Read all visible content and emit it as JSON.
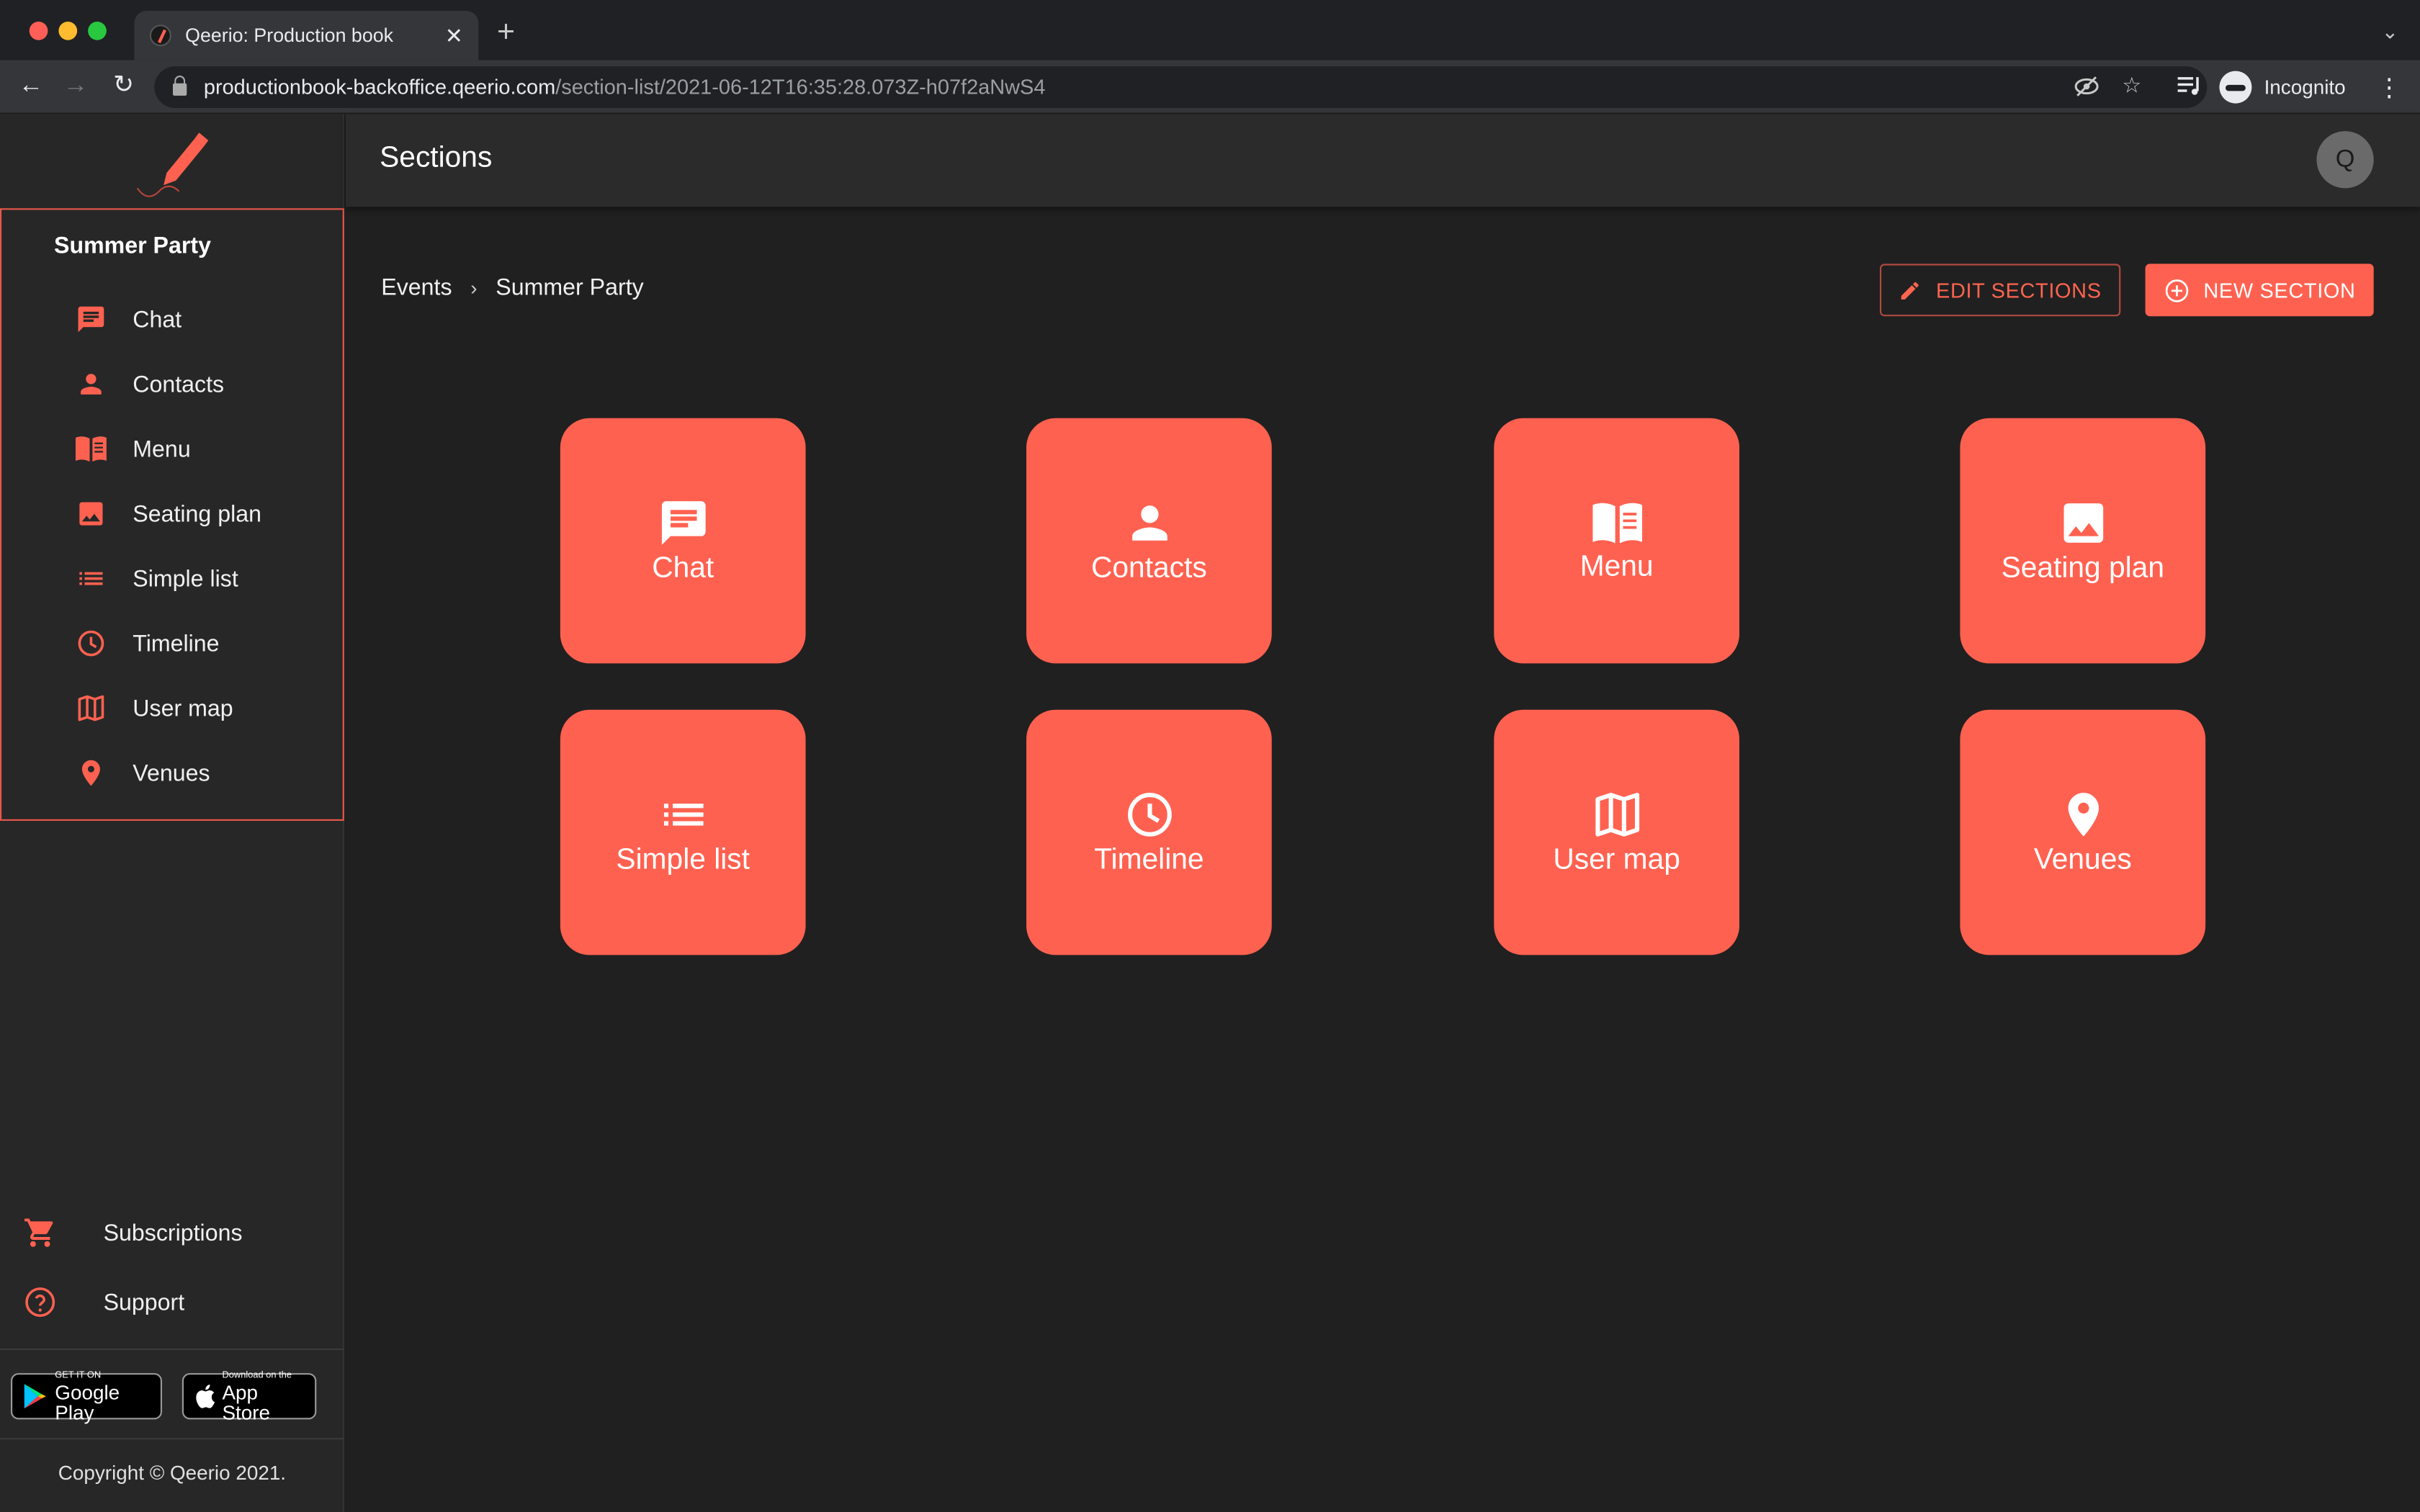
{
  "browser": {
    "tab_title": "Qeerio: Production book",
    "tab_close": "✕",
    "new_tab": "+",
    "url_host": "productionbook-backoffice.qeerio.com",
    "url_path": "/section-list/2021-06-12T16:35:28.073Z-h07f2aNwS4",
    "profile_label": "Incognito"
  },
  "colors": {
    "accent": "#ff6150",
    "background": "#202020",
    "sidebar": "#272727"
  },
  "sidebar": {
    "event_title": "Summer Party",
    "items": [
      {
        "label": "Chat",
        "icon": "chat-icon"
      },
      {
        "label": "Contacts",
        "icon": "person-icon"
      },
      {
        "label": "Menu",
        "icon": "book-icon"
      },
      {
        "label": "Seating plan",
        "icon": "image-icon"
      },
      {
        "label": "Simple list",
        "icon": "list-icon"
      },
      {
        "label": "Timeline",
        "icon": "clock-icon"
      },
      {
        "label": "User map",
        "icon": "map-icon"
      },
      {
        "label": "Venues",
        "icon": "location-pin-icon"
      }
    ],
    "footer_items": [
      {
        "label": "Subscriptions",
        "icon": "cart-icon"
      },
      {
        "label": "Support",
        "icon": "help-icon"
      }
    ],
    "google_play": {
      "small": "GET IT ON",
      "big": "Google Play"
    },
    "app_store": {
      "small": "Download on the",
      "big": "App Store"
    },
    "copyright": "Copyright © Qeerio 2021."
  },
  "header": {
    "title": "Sections",
    "avatar_letter": "Q"
  },
  "breadcrumb": {
    "items": [
      "Events",
      "Summer Party"
    ],
    "separator": "›"
  },
  "actions": {
    "edit_label": "EDIT SECTIONS",
    "new_label": "NEW SECTION"
  },
  "tiles": [
    {
      "label": "Chat",
      "icon": "chat-icon"
    },
    {
      "label": "Contacts",
      "icon": "person-icon"
    },
    {
      "label": "Menu",
      "icon": "book-icon"
    },
    {
      "label": "Seating plan",
      "icon": "image-icon"
    },
    {
      "label": "Simple list",
      "icon": "list-icon"
    },
    {
      "label": "Timeline",
      "icon": "clock-icon"
    },
    {
      "label": "User map",
      "icon": "map-icon"
    },
    {
      "label": "Venues",
      "icon": "location-pin-icon"
    }
  ]
}
